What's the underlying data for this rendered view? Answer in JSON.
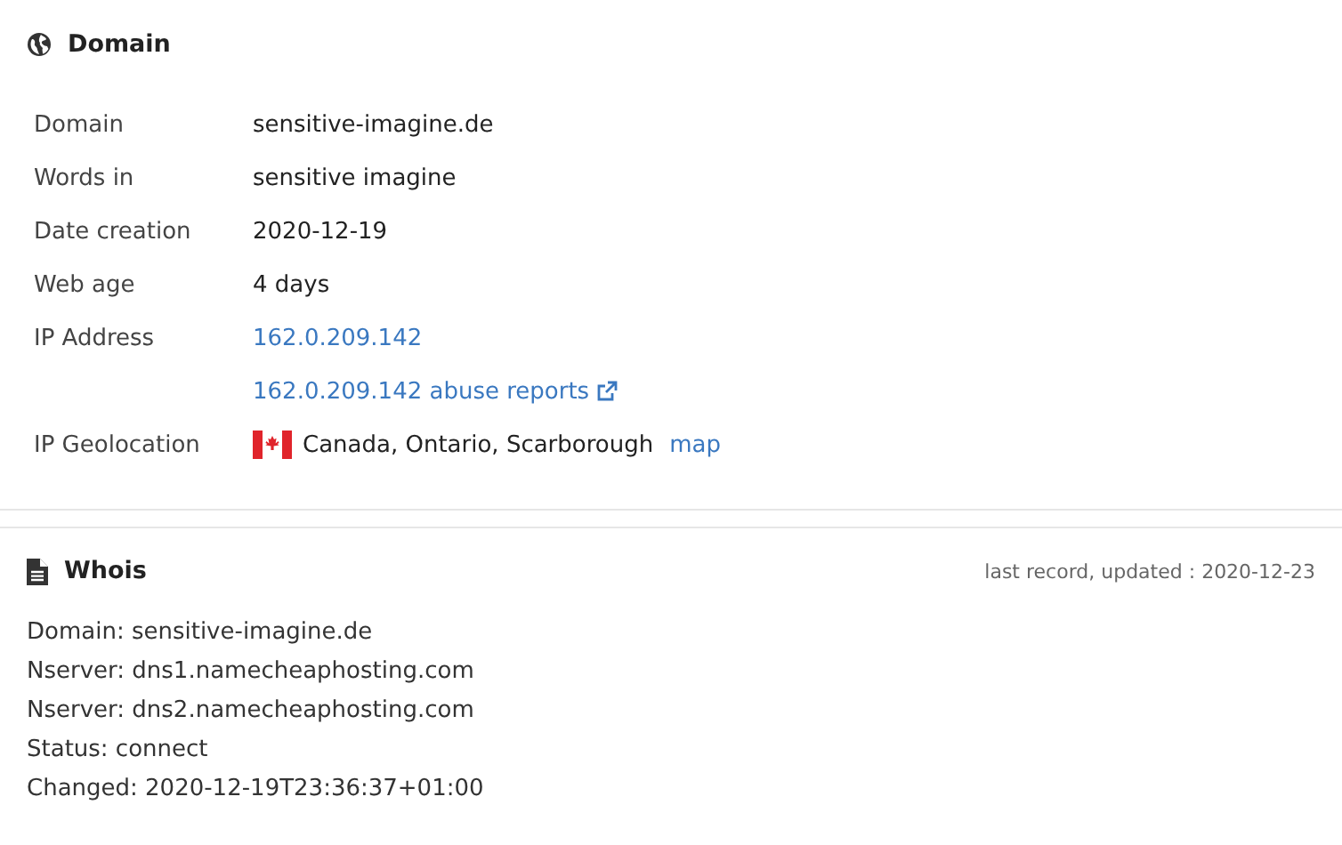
{
  "domain_section": {
    "title": "Domain",
    "rows": [
      {
        "label": "Domain",
        "values": [
          {
            "kind": "text",
            "text": "sensitive-imagine.de"
          }
        ]
      },
      {
        "label": "Words in",
        "values": [
          {
            "kind": "text",
            "text": "sensitive imagine"
          }
        ]
      },
      {
        "label": "Date creation",
        "values": [
          {
            "kind": "text",
            "text": "2020-12-19"
          }
        ]
      },
      {
        "label": "Web age",
        "values": [
          {
            "kind": "text",
            "text": "4 days"
          }
        ]
      },
      {
        "label": "IP Address",
        "values": [
          {
            "kind": "link",
            "text": "162.0.209.142"
          }
        ]
      },
      {
        "label": "",
        "values": [
          {
            "kind": "external_link",
            "text": "162.0.209.142 abuse reports"
          }
        ]
      },
      {
        "label": "IP Geolocation",
        "values": [
          {
            "kind": "flag_text",
            "text": "Canada, Ontario, Scarborough"
          },
          {
            "kind": "link",
            "text": "map"
          }
        ]
      }
    ]
  },
  "whois_section": {
    "title": "Whois",
    "updated": "last record, updated : 2020-12-23",
    "lines": [
      "Domain: sensitive-imagine.de",
      "Nserver: dns1.namecheaphosting.com",
      "Nserver: dns2.namecheaphosting.com",
      "Status: connect",
      "Changed: 2020-12-19T23:36:37+01:00"
    ]
  }
}
